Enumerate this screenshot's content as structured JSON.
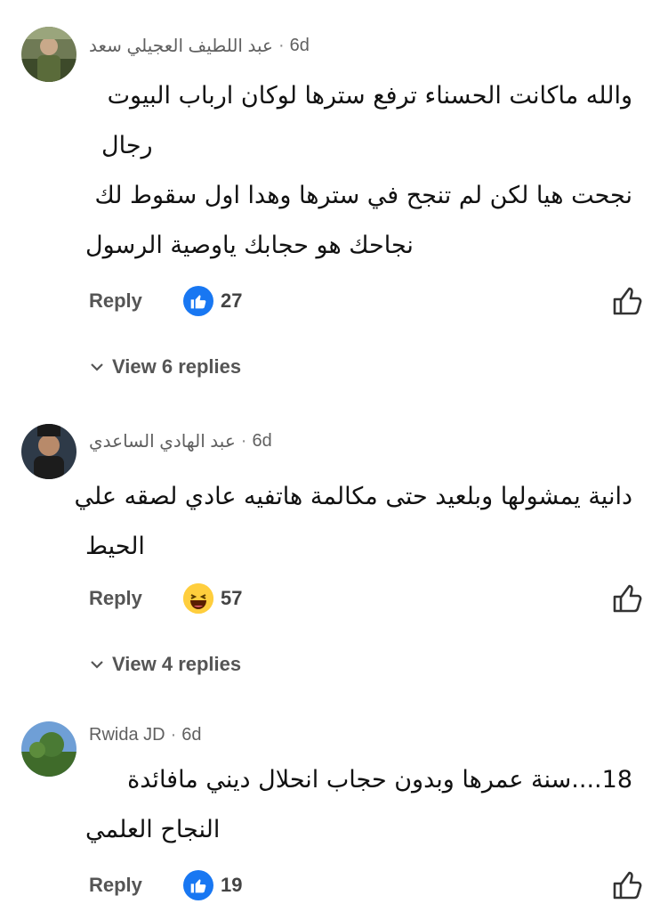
{
  "comments": [
    {
      "name": "عبد اللطيف العجيلي سعد",
      "separator": "·",
      "time": "6d",
      "lines": [
        "والله ماكانت الحسناء ترفع سترها لوكان ارباب البيوت",
        "رجال",
        "نجحت هيا لكن لم تنجح في سترها وهدا اول سقوط لك",
        "نجاحك هو حجابك ياوصية الرسول"
      ],
      "reply_label": "Reply",
      "reaction_icon": "like-reaction-icon",
      "reaction_count": "27",
      "view_replies": "View 6 replies"
    },
    {
      "name": "عبد الهادي الساعدي",
      "separator": "·",
      "time": "6d",
      "lines": [
        "دانية يمشولها وبلعيد حتى مكالمة هاتفيه عادي لصقه علي",
        "الحيط"
      ],
      "reply_label": "Reply",
      "reaction_icon": "haha-reaction-icon",
      "reaction_count": "57",
      "view_replies": "View 4 replies"
    },
    {
      "name": "Rwida JD",
      "separator": "·",
      "time": "6d",
      "lines": [
        "18....سنة عمرها وبدون حجاب انحلال ديني مافائدة",
        "النجاح العلمي"
      ],
      "reply_label": "Reply",
      "reaction_icon": "like-reaction-icon",
      "reaction_count": "19"
    }
  ],
  "colors": {
    "like_blue": "#1877f2",
    "haha_yellow": "#ffce3d",
    "text_dark": "#111111",
    "text_muted": "#555555"
  }
}
